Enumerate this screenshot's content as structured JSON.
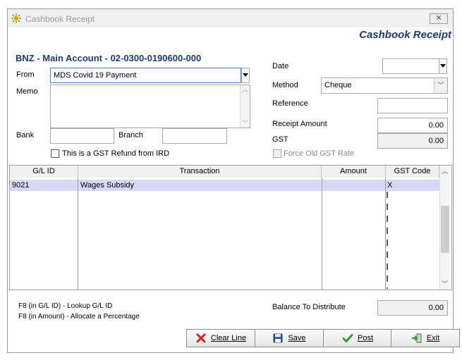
{
  "window": {
    "title": "Cashbook Receipt",
    "close_glyph": "✕"
  },
  "header": {
    "title": "Cashbook Receipt",
    "account": "BNZ - Main Account - 02-0300-0190600-000"
  },
  "form": {
    "from_label": "From",
    "from_value": "MDS Covid 19 Payment",
    "memo_label": "Memo",
    "memo_value": "",
    "bank_label": "Bank",
    "bank_value": "",
    "branch_label": "Branch",
    "branch_value": "",
    "gst_refund_label": "This is a GST Refund from IRD",
    "gst_refund_checked": false,
    "date_label": "Date",
    "date_value": "",
    "method_label": "Method",
    "method_value": "Cheque",
    "reference_label": "Reference",
    "reference_value": "",
    "receipt_amount_label": "Receipt Amount",
    "receipt_amount_value": "0.00",
    "gst_label": "GST",
    "gst_value": "0.00",
    "force_old_gst_label": "Force Old GST Rate",
    "force_old_gst_checked": false
  },
  "grid": {
    "columns": [
      "G/L ID",
      "Transaction",
      "Amount",
      "GST Code"
    ],
    "rows": [
      {
        "gl_id": "9021",
        "transaction": "Wages Subsidy",
        "amount": "",
        "gst_code": "X"
      }
    ]
  },
  "footer": {
    "hint_1": "F8 (in G/L ID) - Lookup G/L ID",
    "hint_2": "F8 (in Amount) - Allocate a Percentage",
    "balance_label": "Balance To Distribute",
    "balance_value": "0.00"
  },
  "buttons": {
    "clear_line": "Clear Line",
    "save": "Save",
    "post": "Post",
    "exit": "Exit"
  },
  "colors": {
    "title_blue": "#1f3a6b",
    "row_highlight": "#d8d8f4",
    "post_green": "#2e9e2e",
    "clear_red": "#d42020"
  }
}
